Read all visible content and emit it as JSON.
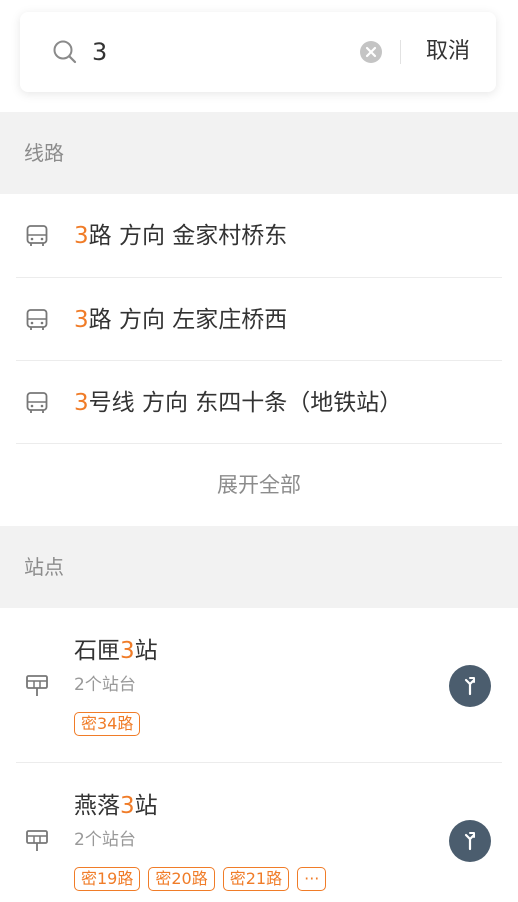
{
  "search": {
    "query": "3",
    "cancel_label": "取消"
  },
  "lines_section": {
    "title": "线路",
    "items": [
      {
        "highlight": "3",
        "rest": "路 方向 金家村桥东"
      },
      {
        "highlight": "3",
        "rest": "路 方向 左家庄桥西"
      },
      {
        "highlight": "3",
        "rest": "号线 方向 东四十条（地铁站）"
      }
    ],
    "expand_label": "展开全部"
  },
  "stops_section": {
    "title": "站点",
    "items": [
      {
        "name_pre": "石匣",
        "name_hl": "3",
        "name_post": "站",
        "sub": "2个站台",
        "tags": [
          "密34路"
        ]
      },
      {
        "name_pre": "燕落",
        "name_hl": "3",
        "name_post": "站",
        "sub": "2个站台",
        "tags": [
          "密19路",
          "密20路",
          "密21路",
          "···"
        ]
      }
    ]
  },
  "icons": {
    "search": "search-icon",
    "clear": "clear-icon",
    "bus": "bus-icon",
    "stop": "bus-stop-icon",
    "navigate": "navigate-icon"
  },
  "colors": {
    "accent": "#f07c28",
    "nav_button": "#4b5d6e",
    "section_bg": "#f2f2f2"
  }
}
